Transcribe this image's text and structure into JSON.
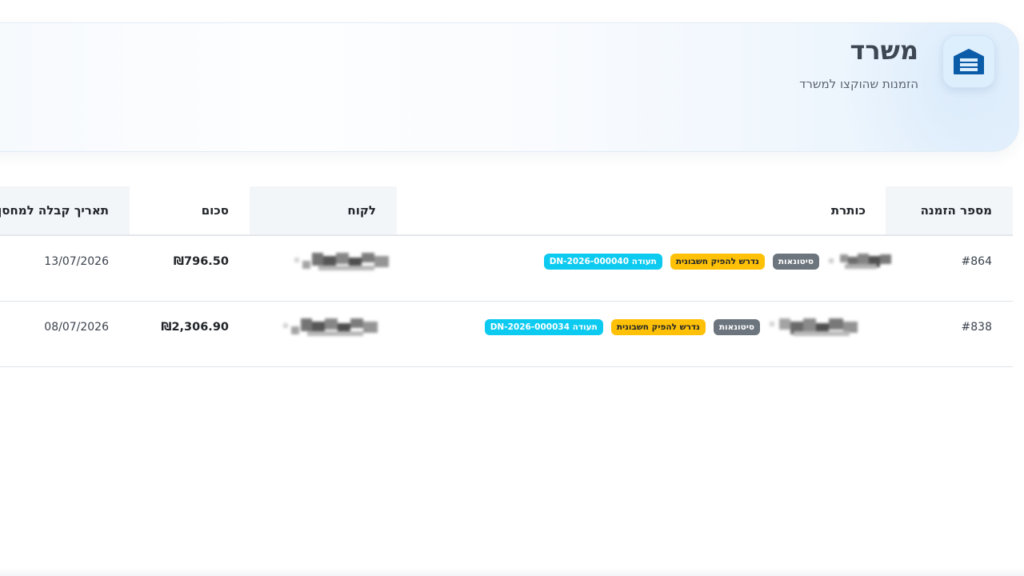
{
  "header": {
    "title": "משרד",
    "subtitle": "הזמנות שהוקצו למשרד",
    "icon": "warehouse-icon",
    "accent_color": "#0b5ca8"
  },
  "table": {
    "columns": {
      "order_number": "מספר הזמנה",
      "title": "כותרת",
      "customer": "לקוח",
      "amount": "סכום",
      "warehouse_date": "תאריך קבלה למחסן"
    },
    "rows": [
      {
        "order_number": "#864",
        "badges": {
          "category": "סיטונאות",
          "invoice_required": "נדרש להפיק חשבונית",
          "document": "תעודה DN-2026-000040"
        },
        "amount": "₪796.50",
        "warehouse_date": "13/07/2026"
      },
      {
        "order_number": "#838",
        "badges": {
          "category": "סיטונאות",
          "invoice_required": "נדרש להפיק חשבונית",
          "document": "תעודה DN-2026-000034"
        },
        "amount": "₪2,306.90",
        "warehouse_date": "08/07/2026"
      }
    ]
  },
  "colors": {
    "badge_gray": "#6c757d",
    "badge_yellow": "#ffc107",
    "badge_cyan": "#0dcaf0",
    "header_bg": "#f3f6f9"
  }
}
